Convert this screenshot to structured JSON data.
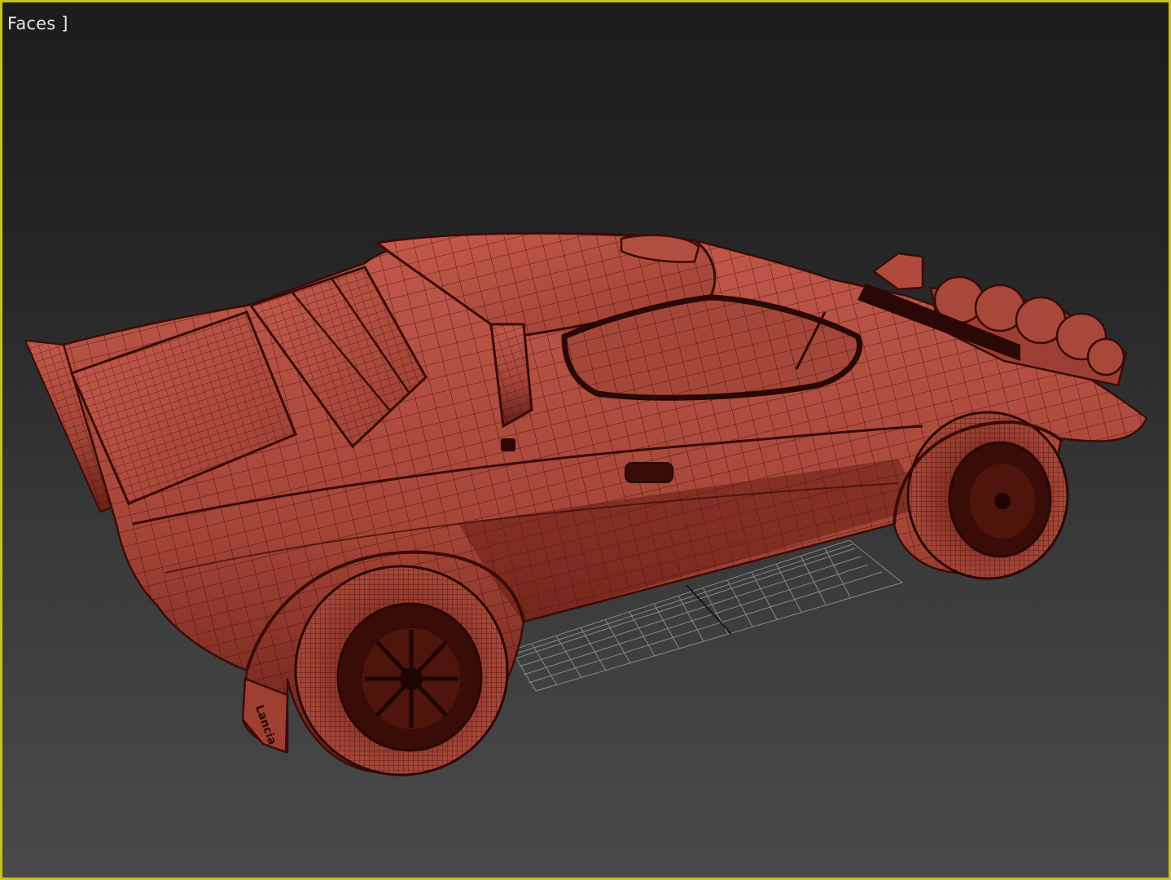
{
  "viewport": {
    "label": "Faces ]",
    "border_color": "#c8c21c",
    "active": true
  },
  "scene": {
    "object": "rally-car-wireframe",
    "shading": "faces",
    "model_color": "#b04a3c",
    "wire_color": "#3a0c08",
    "grid_color": "#9a9a9a",
    "mudflap_text": "Lancia"
  }
}
